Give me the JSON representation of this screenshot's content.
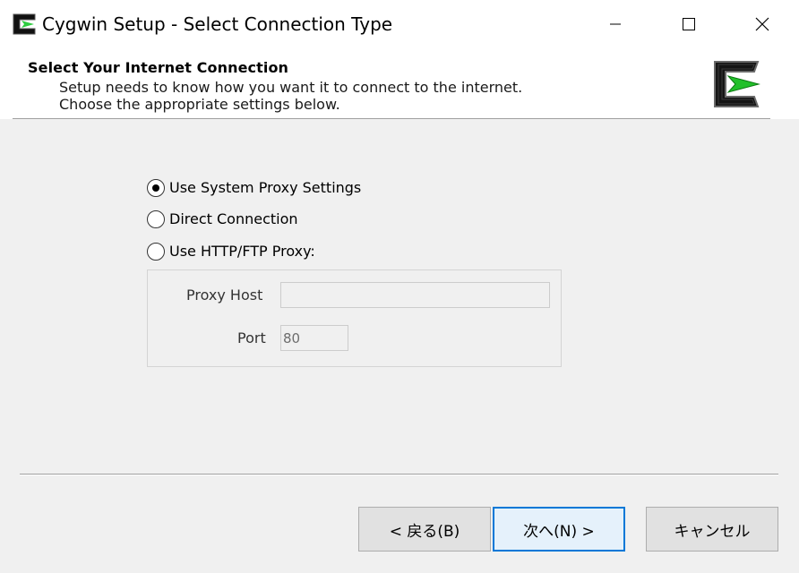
{
  "window": {
    "title": "Cygwin Setup - Select Connection Type",
    "app_icon": "cygwin-logo-icon",
    "controls": [
      "minimize-icon",
      "maximize-icon",
      "close-icon"
    ]
  },
  "header": {
    "title": "Select Your Internet Connection",
    "description_line1": "Setup needs to know how you want it to connect to the internet.",
    "description_line2": "Choose the appropriate settings below.",
    "logo": "cygwin-logo-icon"
  },
  "connection_options": [
    {
      "label": "Use System Proxy Settings",
      "selected": true
    },
    {
      "label": "Direct Connection",
      "selected": false
    },
    {
      "label": "Use HTTP/FTP Proxy:",
      "selected": false
    }
  ],
  "proxy": {
    "host_label": "Proxy Host",
    "host_value": "",
    "port_label": "Port",
    "port_value": "80",
    "enabled": false
  },
  "buttons": {
    "back": "< 戻る(B)",
    "next": "次へ(N) >",
    "cancel": "キャンセル"
  },
  "colors": {
    "accent": "#0078d7",
    "logo_green": "#22c02a",
    "background": "#f0f0f0"
  }
}
